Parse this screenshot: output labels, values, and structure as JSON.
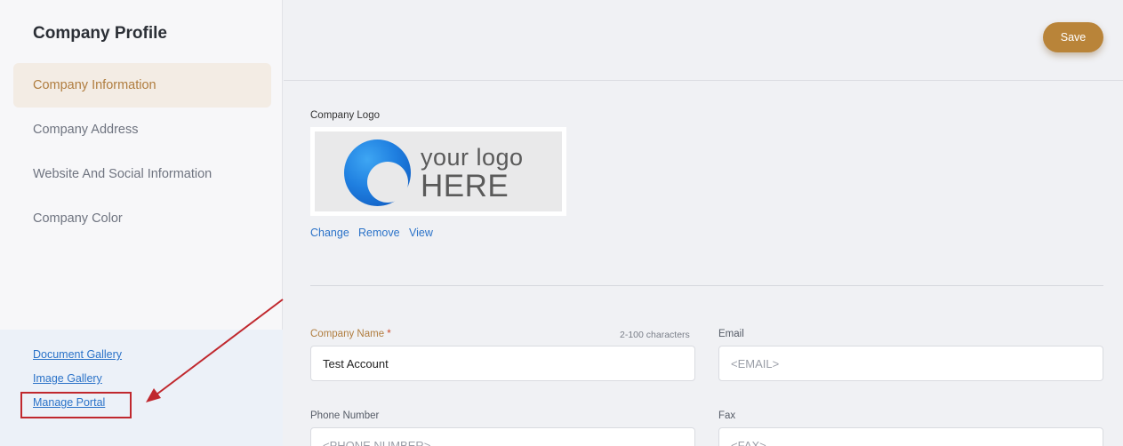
{
  "sidebar": {
    "title": "Company Profile",
    "items": [
      {
        "label": "Company Information"
      },
      {
        "label": "Company Address"
      },
      {
        "label": "Website And Social Information"
      },
      {
        "label": "Company Color"
      }
    ],
    "links": [
      {
        "label": "Document Gallery"
      },
      {
        "label": "Image Gallery"
      },
      {
        "label": "Manage Portal"
      }
    ]
  },
  "toolbar": {
    "save_label": "Save"
  },
  "logo_section": {
    "label": "Company Logo",
    "logo_line1": "your logo",
    "logo_line2": "HERE",
    "actions": [
      "Change",
      "Remove",
      "View"
    ]
  },
  "form": {
    "company_name": {
      "label": "Company Name",
      "required": "*",
      "hint": "2-100 characters",
      "value": "Test Account"
    },
    "email": {
      "label": "Email",
      "placeholder": "<EMAIL>"
    },
    "phone": {
      "label": "Phone Number",
      "placeholder": "<PHONE NUMBER>"
    },
    "fax": {
      "label": "Fax",
      "placeholder": "<FAX>"
    }
  },
  "colors": {
    "accent": "#b98439",
    "link": "#2a72c8",
    "annotation": "#c0282e"
  }
}
